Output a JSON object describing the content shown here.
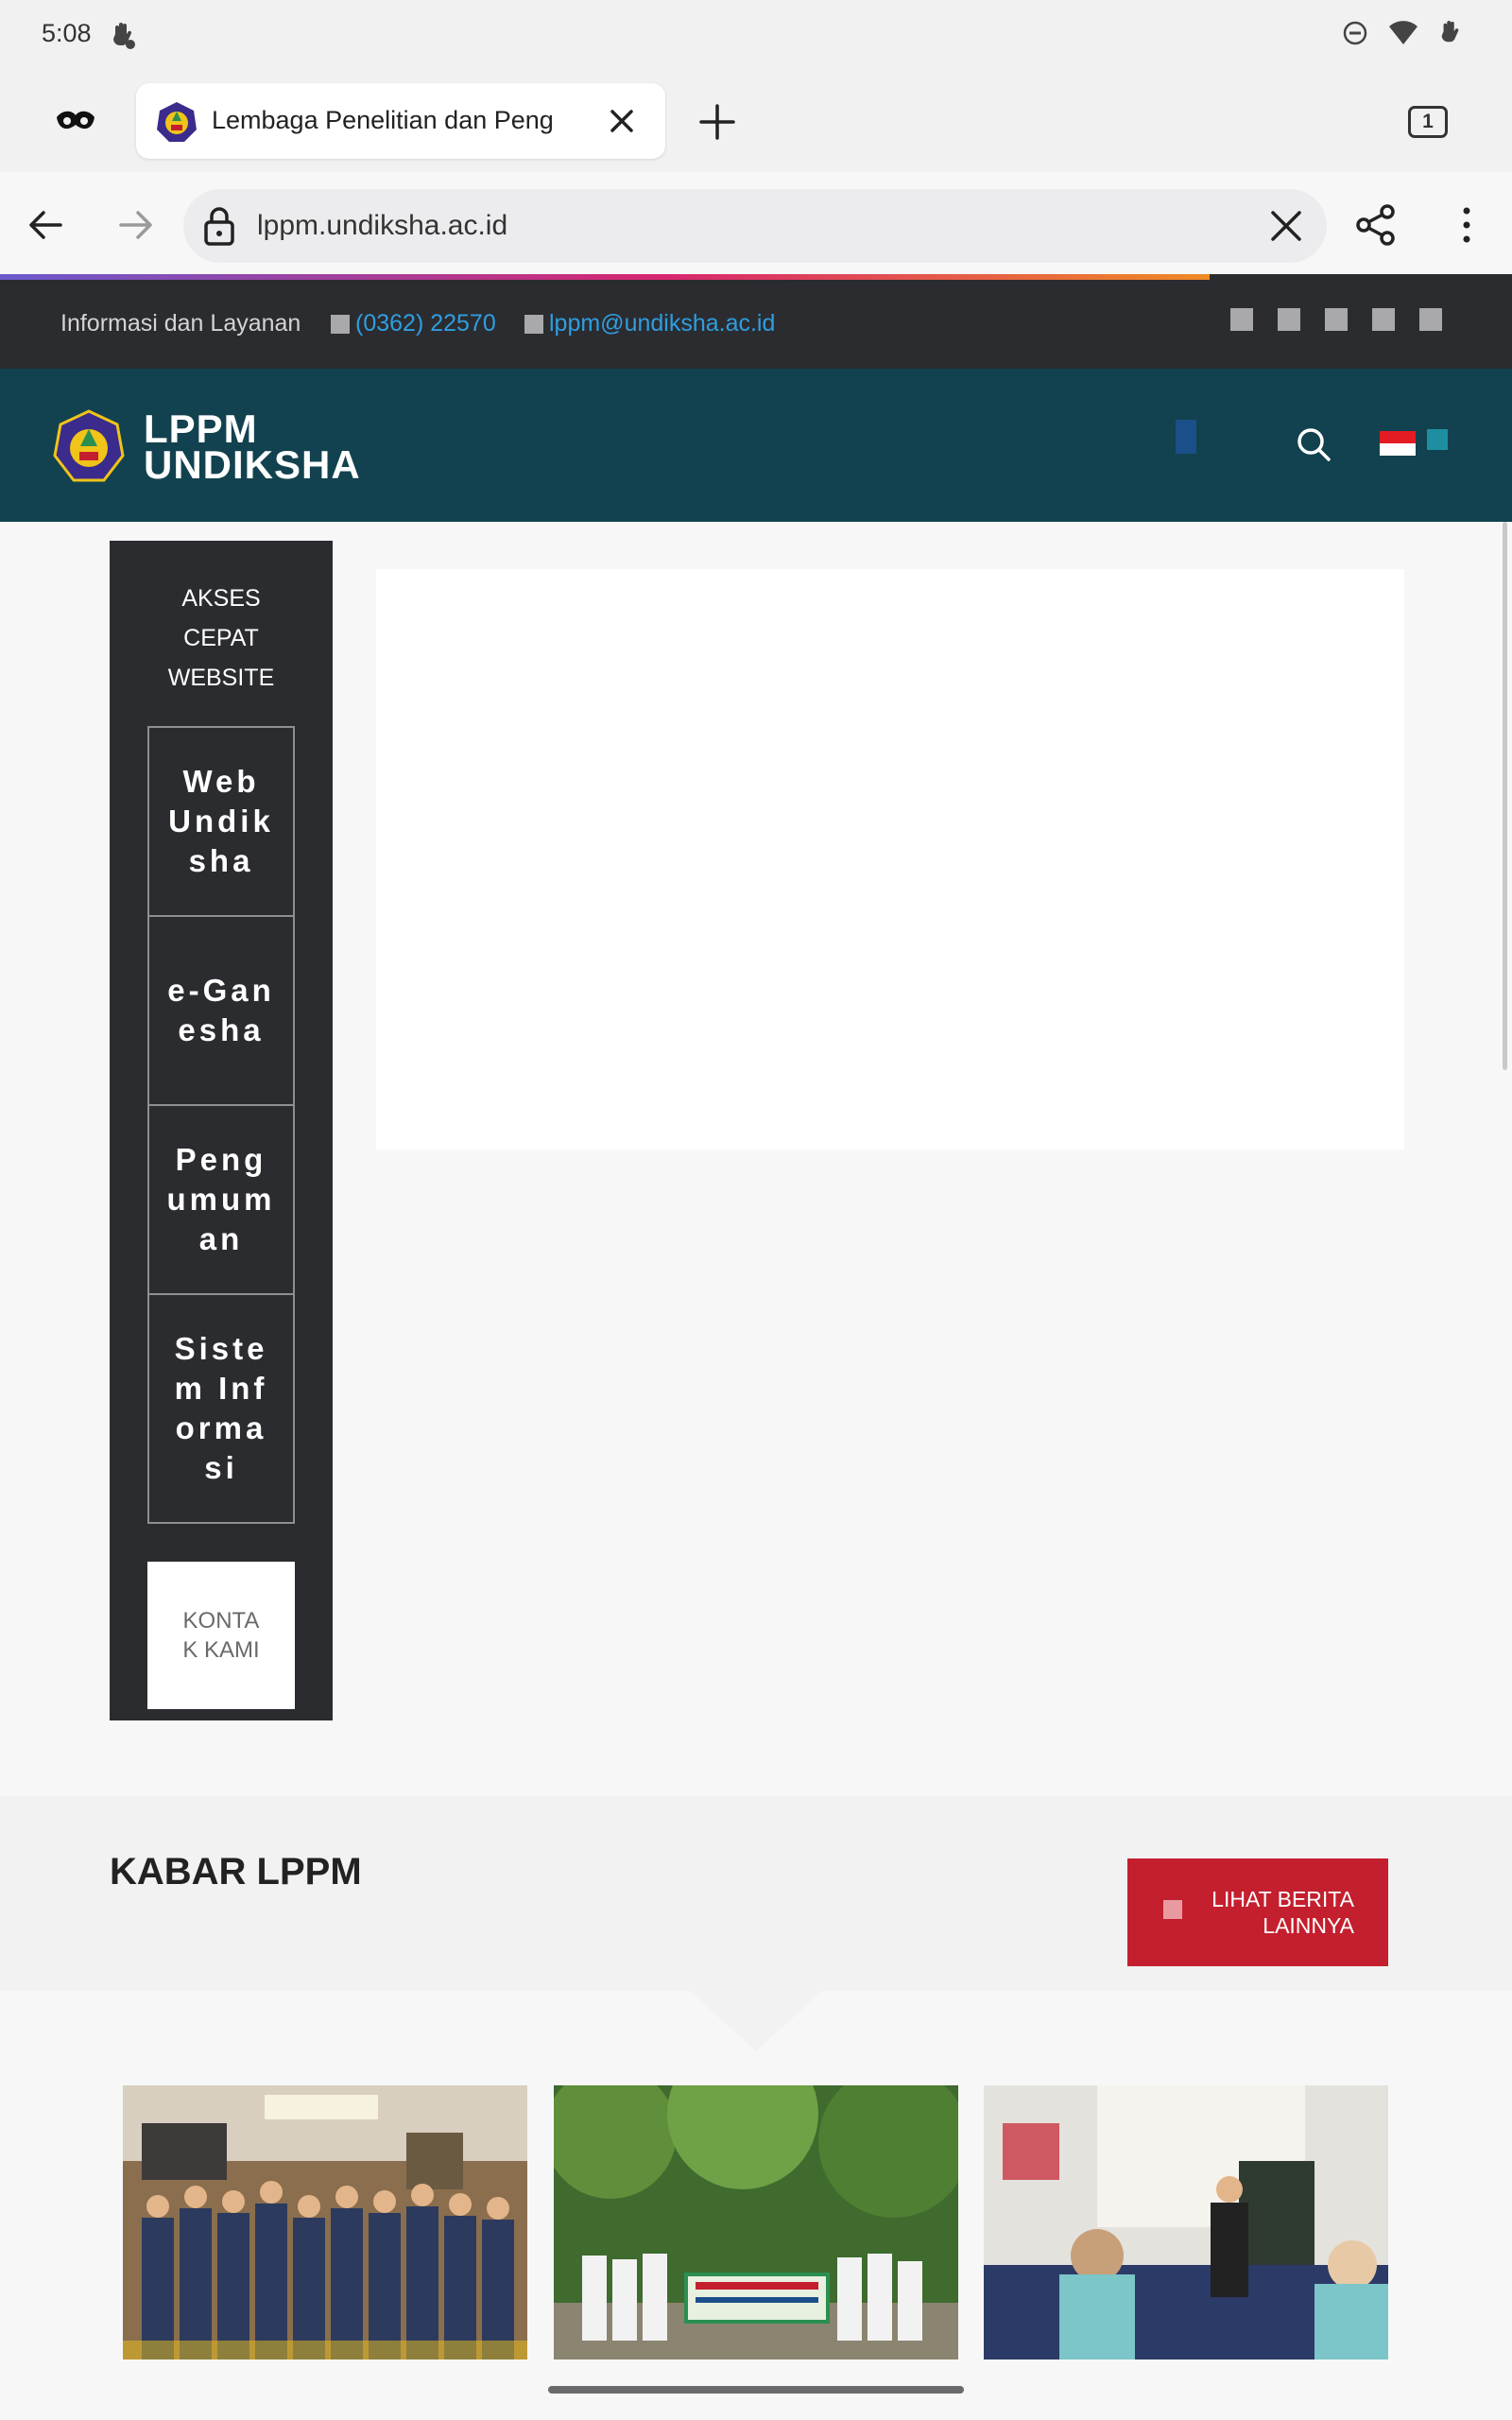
{
  "status_bar": {
    "time": "5:08"
  },
  "browser": {
    "tab": {
      "title": "Lembaga Penelitian dan Peng"
    },
    "tab_count": "1",
    "url": "lppm.undiksha.ac.id",
    "load_progress": 0.8
  },
  "info_bar": {
    "label": "Informasi dan Layanan",
    "phone": "(0362) 22570",
    "email": "lppm@undiksha.ac.id"
  },
  "header": {
    "logo_line1": "LPPM",
    "logo_line2": "UNDIKSHA"
  },
  "quick_access": {
    "title": [
      "AKSES",
      "CEPAT",
      "WEBSITE"
    ],
    "items": [
      "Web Undiksha",
      "e-Ganesha",
      "Pengumuman",
      "Sistem Informasi"
    ],
    "contact": "KONTAK KAMI"
  },
  "news": {
    "title": "KABAR LPPM",
    "button_line1": "LIHAT BERITA",
    "button_line2": "LAINNYA"
  },
  "colors": {
    "info_bar_bg": "#2b2c30",
    "header_bg": "#12424f",
    "link": "#2f9ee0",
    "accent_red": "#c41f2e"
  }
}
